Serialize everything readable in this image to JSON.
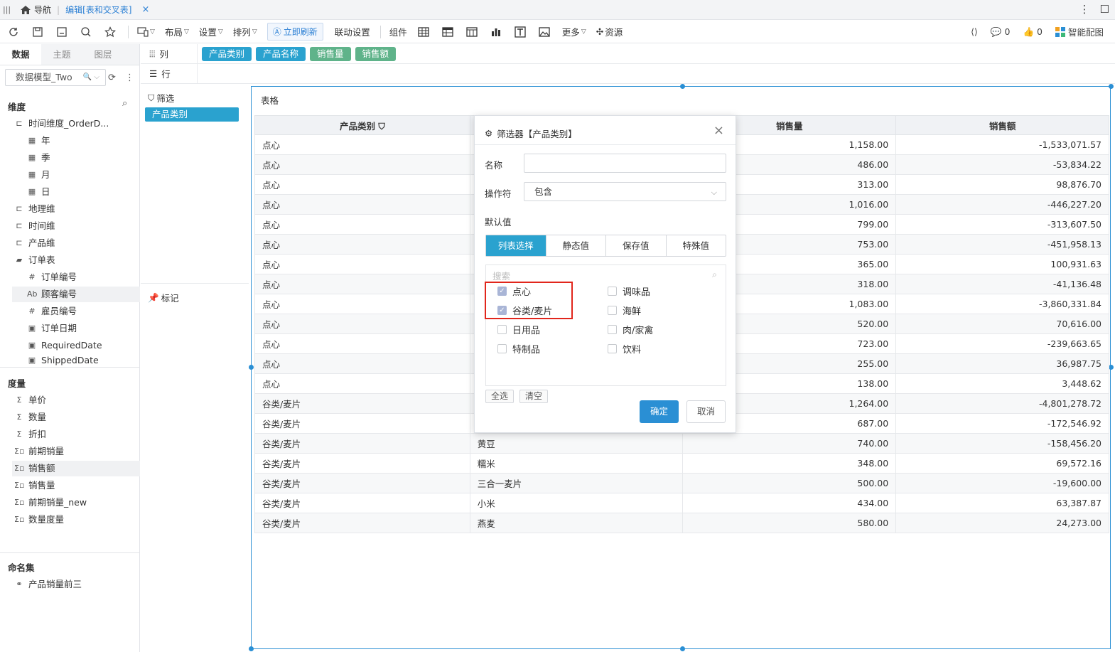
{
  "nav": {
    "home_label": "导航",
    "tab_label": "编辑[表和交叉表]",
    "close": "×"
  },
  "toolbar": {
    "layout_label": "布局",
    "settings_label": "设置",
    "sort_label": "排列",
    "refresh_label": "立即刷新",
    "link_label": "联动设置",
    "component_label": "组件",
    "more_label": "更多",
    "resource_label": "资源",
    "comments_count": "0",
    "likes_count": "0",
    "smart_label": "智能配图"
  },
  "left": {
    "tabs": [
      "数据",
      "主题",
      "图层"
    ],
    "model_select": "数据模型_Two",
    "dimensions_title": "维度",
    "dimension_items": [
      {
        "label": "时间维度_OrderD..."
      },
      {
        "label": "年"
      },
      {
        "label": "季"
      },
      {
        "label": "月"
      },
      {
        "label": "日"
      },
      {
        "label": "地理维"
      },
      {
        "label": "时间维"
      },
      {
        "label": "产品维"
      },
      {
        "label": "订单表"
      },
      {
        "label": "订单编号"
      },
      {
        "label": "顾客编号"
      },
      {
        "label": "雇员编号"
      },
      {
        "label": "订单日期"
      },
      {
        "label": "RequiredDate"
      },
      {
        "label": "ShippedDate"
      }
    ],
    "measures_title": "度量",
    "measure_items": [
      {
        "label": "单价"
      },
      {
        "label": "数量"
      },
      {
        "label": "折扣"
      },
      {
        "label": "前期销量"
      },
      {
        "label": "销售额"
      },
      {
        "label": "销售量"
      },
      {
        "label": "前期销量_new"
      },
      {
        "label": "数量度量"
      }
    ],
    "named_sets_title": "命名集",
    "named_set_items": [
      {
        "label": "产品销量前三"
      }
    ]
  },
  "shelves": {
    "columns_label": "列",
    "column_pills": [
      "产品类别",
      "产品名称",
      "销售量",
      "销售额"
    ],
    "rows_label": "行",
    "filter_label": "筛选",
    "filter_pill": "产品类别",
    "mark_label": "标记"
  },
  "widget": {
    "title": "表格",
    "headers": [
      "产品类别",
      "销售量",
      "销售额"
    ],
    "rows": [
      {
        "cat": "点心",
        "name": "",
        "qty": "1,158.00",
        "amt": "-1,533,071.57"
      },
      {
        "cat": "点心",
        "name": "",
        "qty": "486.00",
        "amt": "-53,834.22"
      },
      {
        "cat": "点心",
        "name": "",
        "qty": "313.00",
        "amt": "98,876.70"
      },
      {
        "cat": "点心",
        "name": "",
        "qty": "1,016.00",
        "amt": "-446,227.20"
      },
      {
        "cat": "点心",
        "name": "",
        "qty": "799.00",
        "amt": "-313,607.50"
      },
      {
        "cat": "点心",
        "name": "",
        "qty": "753.00",
        "amt": "-451,958.13"
      },
      {
        "cat": "点心",
        "name": "",
        "qty": "365.00",
        "amt": "100,931.63"
      },
      {
        "cat": "点心",
        "name": "",
        "qty": "318.00",
        "amt": "-41,136.48"
      },
      {
        "cat": "点心",
        "name": "",
        "qty": "1,083.00",
        "amt": "-3,860,331.84"
      },
      {
        "cat": "点心",
        "name": "",
        "qty": "520.00",
        "amt": "70,616.00"
      },
      {
        "cat": "点心",
        "name": "",
        "qty": "723.00",
        "amt": "-239,663.65"
      },
      {
        "cat": "点心",
        "name": "",
        "qty": "255.00",
        "amt": "36,987.75"
      },
      {
        "cat": "点心",
        "name": "",
        "qty": "138.00",
        "amt": "3,448.62"
      },
      {
        "cat": "谷类/麦片",
        "name": "",
        "qty": "1,264.00",
        "amt": "-4,801,278.72"
      },
      {
        "cat": "谷类/麦片",
        "name": "",
        "qty": "687.00",
        "amt": "-172,546.92"
      },
      {
        "cat": "谷类/麦片",
        "name": "黄豆",
        "qty": "740.00",
        "amt": "-158,456.20"
      },
      {
        "cat": "谷类/麦片",
        "name": "糯米",
        "qty": "348.00",
        "amt": "69,572.16"
      },
      {
        "cat": "谷类/麦片",
        "name": "三合一麦片",
        "qty": "500.00",
        "amt": "-19,600.00"
      },
      {
        "cat": "谷类/麦片",
        "name": "小米",
        "qty": "434.00",
        "amt": "63,387.87"
      },
      {
        "cat": "谷类/麦片",
        "name": "燕麦",
        "qty": "580.00",
        "amt": "24,273.00"
      }
    ]
  },
  "dialog": {
    "title": "筛选器【产品类别】",
    "name_label": "名称",
    "name_value": "",
    "operator_label": "操作符",
    "operator_value": "包含",
    "default_label": "默认值",
    "segments": [
      "列表选择",
      "静态值",
      "保存值",
      "特殊值"
    ],
    "search_placeholder": "搜索",
    "options_left": [
      {
        "label": "点心",
        "checked": true
      },
      {
        "label": "谷类/麦片",
        "checked": true
      },
      {
        "label": "日用品",
        "checked": false
      },
      {
        "label": "特制品",
        "checked": false
      }
    ],
    "options_right": [
      {
        "label": "调味品",
        "checked": false
      },
      {
        "label": "海鲜",
        "checked": false
      },
      {
        "label": "肉/家禽",
        "checked": false
      },
      {
        "label": "饮料",
        "checked": false
      }
    ],
    "select_all": "全选",
    "clear": "清空",
    "ok": "确定",
    "cancel": "取消"
  }
}
